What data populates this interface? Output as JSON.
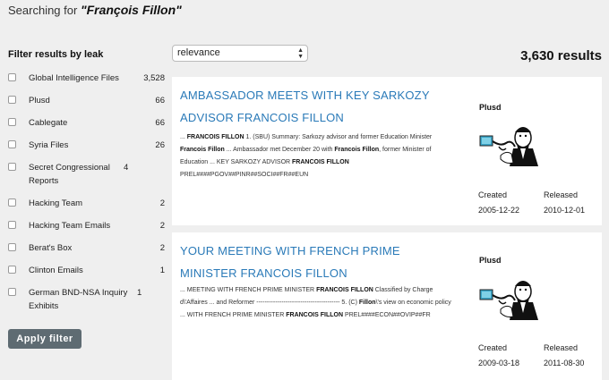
{
  "search": {
    "prefix": "Searching for",
    "query": "\"François Fillon\""
  },
  "filters": {
    "title": "Filter results by leak",
    "items": [
      {
        "label": "Global Intelligence Files",
        "count": "3,528"
      },
      {
        "label": "Plusd",
        "count": "66"
      },
      {
        "label": "Cablegate",
        "count": "66"
      },
      {
        "label": "Syria Files",
        "count": "26"
      },
      {
        "label": "Secret Congressional Reports",
        "count": "4"
      },
      {
        "label": "Hacking Team",
        "count": "2"
      },
      {
        "label": "Hacking Team Emails",
        "count": "2"
      },
      {
        "label": "Berat's Box",
        "count": "2"
      },
      {
        "label": "Clinton Emails",
        "count": "1"
      },
      {
        "label": "German BND-NSA Inquiry Exhibits",
        "count": "1"
      }
    ],
    "apply_label": "Apply filter"
  },
  "sort": {
    "selected": "relevance"
  },
  "results_count": "3,630 results",
  "results": [
    {
      "title": "AMBASSADOR MEETS WITH KEY SARKOZY ADVISOR FRANCOIS FILLON",
      "snippet": [
        {
          "t": "... "
        },
        {
          "b": "FRANCOIS FILLON"
        },
        {
          "t": " 1. (SBU) Summary: Sarkozy advisor and former Education Minister "
        },
        {
          "b": "Francois Fillon"
        },
        {
          "t": " ... Ambassador met December 20 with "
        },
        {
          "b": "Francois Fillon"
        },
        {
          "t": ", former Minister of Education ... KEY SARKOZY ADVISOR "
        },
        {
          "b": "FRANCOIS FILLON"
        },
        {
          "t": " PREL####PGOV##PINR##SOCI##FR##EUN"
        }
      ],
      "leak": "Plusd",
      "created_label": "Created",
      "created": "2005-12-22",
      "released_label": "Released",
      "released": "2010-12-01"
    },
    {
      "title": "YOUR MEETING WITH FRENCH PRIME MINISTER FRANCOIS FILLON",
      "snippet": [
        {
          "t": "... MEETING WITH FRENCH PRIME MINISTER "
        },
        {
          "b": "FRANCOIS FILLON"
        },
        {
          "t": " Classified by Charge d\\'Affaires ... and Reformer ---------------------------------------- 5. (C) "
        },
        {
          "b": "Fillon"
        },
        {
          "t": "\\'s view on economic policy ... WITH FRENCH PRIME MINISTER "
        },
        {
          "b": "FRANCOIS FILLON"
        },
        {
          "t": " PREL####ECON##OVIP##FR"
        }
      ],
      "leak": "Plusd",
      "created_label": "Created",
      "created": "2009-03-18",
      "released_label": "Released",
      "released": "2011-08-30"
    }
  ],
  "icons": {
    "checkbox": "checkbox-icon",
    "leak_logo": "plusd-logo-icon",
    "dropdown": "chevron-down-icon"
  },
  "colors": {
    "link": "#2a7ab8",
    "button": "#5e6b72",
    "background": "#efefef"
  }
}
